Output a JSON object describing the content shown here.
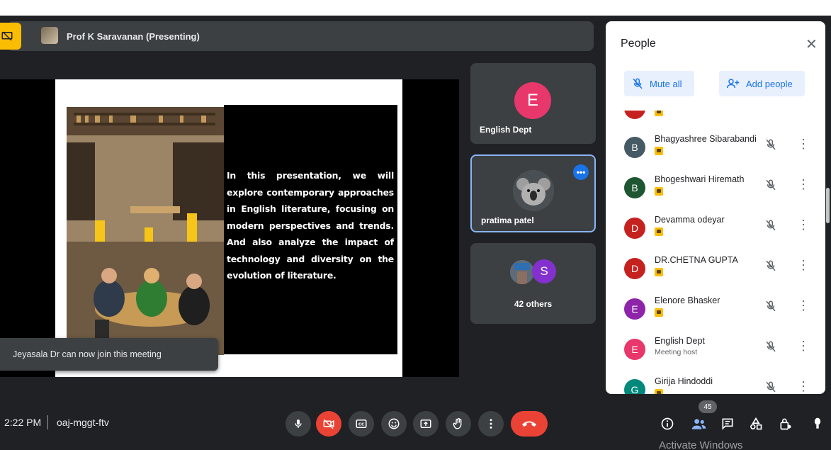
{
  "presenter": {
    "name": "Prof K Saravanan (Presenting)"
  },
  "slide": {
    "text": "In this presentation, we will explore contemporary approaches in English literature, focusing on modern perspectives and trends. And also analyze the impact of technology and diversity on the evolution of literature."
  },
  "toast": {
    "message": "Jeyasala Dr can now join this meeting"
  },
  "tiles": [
    {
      "name": "English Dept",
      "initial": "E",
      "color": "#e8376b"
    },
    {
      "name": "pratima patel"
    },
    {
      "name": "42 others",
      "initial": "S",
      "color": "#8430ce"
    }
  ],
  "people_panel": {
    "title": "People",
    "close_glyph": "✕",
    "mute_all_label": "Mute all",
    "add_people_label": "Add people",
    "participants": [
      {
        "name": "Bhagyashree Sibarabandi",
        "initial": "B",
        "color": "#455a64"
      },
      {
        "name": "Bhogeshwari Hiremath",
        "initial": "B",
        "color": "#1e5631"
      },
      {
        "name": "Devamma odeyar",
        "initial": "D",
        "color": "#c5221f"
      },
      {
        "name": "DR.CHETNA GUPTA",
        "initial": "D",
        "color": "#c5221f"
      },
      {
        "name": "Elenore Bhasker",
        "initial": "E",
        "color": "#8e24aa"
      },
      {
        "name": "English Dept",
        "initial": "E",
        "color": "#e8376b",
        "subtitle": "Meeting host"
      },
      {
        "name": "Girija Hindoddi",
        "initial": "G",
        "color": "#00897b"
      }
    ]
  },
  "bottom_bar": {
    "time": "2:22 PM",
    "meeting_code": "oaj-mggt-ftv",
    "people_count": "45"
  },
  "watermark": "Activate Windows",
  "colors": {
    "accent": "#8ab4f8",
    "danger": "#ea4335",
    "present": "#fbbc04",
    "bar": "#3c4043"
  }
}
